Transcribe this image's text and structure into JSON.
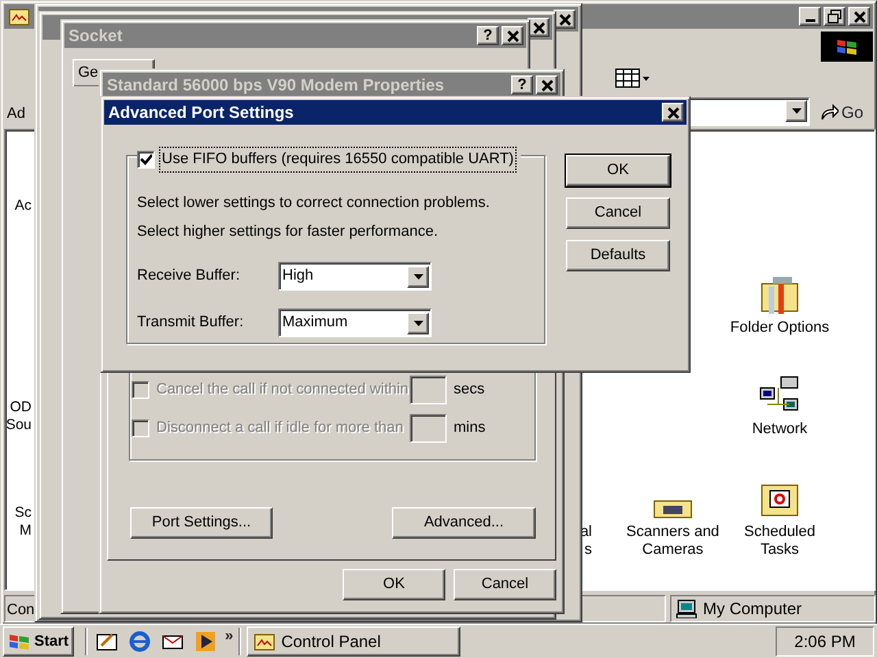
{
  "explorer": {
    "address_label": "Ad",
    "go_label": "Go",
    "left_items": [
      {
        "lines": [
          "Ac"
        ]
      },
      {
        "lines": [
          "OD",
          "Sou"
        ]
      },
      {
        "lines": [
          "Sc",
          "M"
        ]
      }
    ],
    "right_items": [
      {
        "kind": "folder-options",
        "lines": [
          "Folder Options"
        ]
      },
      {
        "kind": "network",
        "lines": [
          "Network"
        ]
      },
      {
        "kind": "partial",
        "lines": [
          "al",
          "s"
        ]
      },
      {
        "kind": "scanners",
        "lines": [
          "Scanners and",
          "Cameras"
        ]
      },
      {
        "kind": "tasks",
        "lines": [
          "Scheduled",
          "Tasks"
        ]
      }
    ],
    "status_left": "Con",
    "status_right": "My Computer"
  },
  "back_windows": [
    {
      "kind": "dialog"
    },
    {
      "kind": "dialog"
    },
    {
      "kind": "dialog",
      "title": "Socket",
      "help": "?",
      "tab": "Ge"
    }
  ],
  "modem": {
    "title": "Standard 56000 bps V90 Modem Properties",
    "help": "?",
    "options": [
      {
        "label": "Cancel the call if not connected within",
        "unit": "secs",
        "checked": false,
        "disabled": true
      },
      {
        "label": "Disconnect a call if idle for more than",
        "unit": "mins",
        "checked": false,
        "disabled": true
      }
    ],
    "port_button": "Port Settings...",
    "advanced_button": "Advanced...",
    "buttons": [
      "OK",
      "Cancel"
    ]
  },
  "advanced": {
    "title": "Advanced Port Settings",
    "fifo": {
      "label": "Use FIFO buffers (requires 16550 compatible UART)",
      "checked": true
    },
    "hints": [
      "Select lower settings to correct connection problems.",
      "Select higher settings for faster performance."
    ],
    "fields": [
      {
        "label": "Receive Buffer:",
        "value": "High"
      },
      {
        "label": "Transmit Buffer:",
        "value": "Maximum"
      }
    ],
    "buttons": [
      {
        "label": "OK",
        "default": true
      },
      {
        "label": "Cancel",
        "default": false
      },
      {
        "label": "Defaults",
        "default": false
      }
    ]
  },
  "taskbar": {
    "start": "Start",
    "chevron": "»",
    "task": "Control Panel",
    "clock": "2:06 PM"
  }
}
